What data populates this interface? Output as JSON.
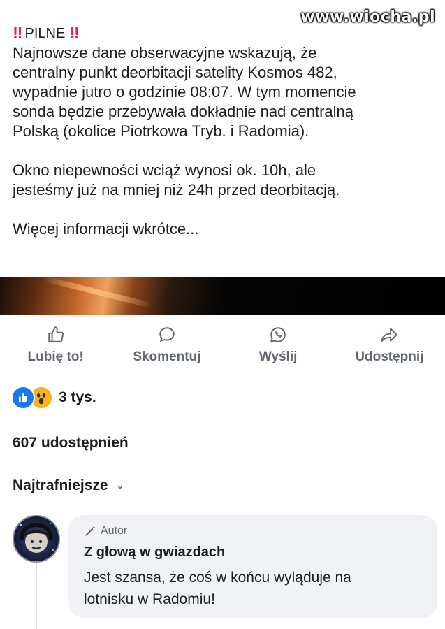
{
  "watermark": "www.wiocha.pl",
  "post": {
    "title_marks": "‼",
    "title": "PILNE",
    "paragraph1": "Najnowsze dane obserwacyjne wskazują, że\ncentralny punkt deorbitacji satelity Kosmos 482,\nwypadnie jutro o godzinie 08:07. W tym momencie\nsonda będzie przebywała dokładnie nad centralną\nPolską (okolice Piotrkowa Tryb. i Radomia).",
    "paragraph2": "Okno niepewności wciąż wynosi ok. 10h, ale\njesteśmy już na mniej niż 24h przed deorbitacją.",
    "paragraph3": "Więcej informacji wkrótce..."
  },
  "actions": {
    "like": "Lubię to!",
    "comment": "Skomentuj",
    "send": "Wyślij",
    "share": "Udostępnij"
  },
  "reactions": {
    "count": "3 tys.",
    "types": [
      "like",
      "wow"
    ]
  },
  "shares": "607 udostępnień",
  "sort": {
    "label": "Najtrafniejsze",
    "chevron": "⌄"
  },
  "comment": {
    "author_tag": "Autor",
    "name": "Z głową w gwiazdach",
    "text": "Jest szansa, że coś w końcu wyląduje na\nlotnisku w Radomiu!"
  },
  "colors": {
    "action_gray": "#65676b",
    "like_blue": "#1877f2",
    "wow_yellow": "#f7b125",
    "bubble": "#f0f2f5",
    "bang_red": "#e0245e"
  }
}
